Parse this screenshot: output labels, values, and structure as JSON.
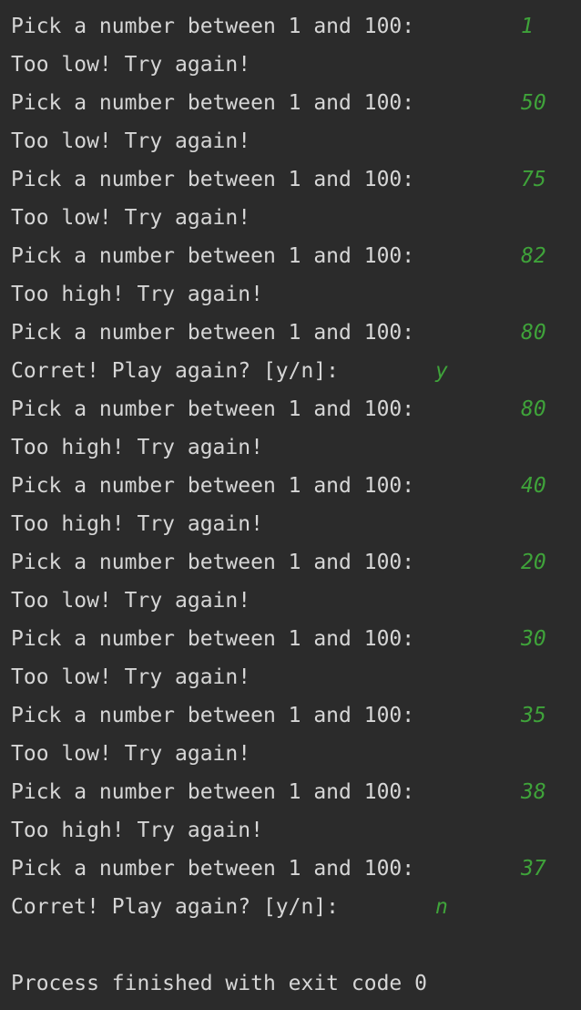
{
  "console": {
    "lines": [
      {
        "kind": "prompt",
        "text": "Pick a number between 1 and 100:",
        "input": "1"
      },
      {
        "kind": "output",
        "text": "Too low! Try again!"
      },
      {
        "kind": "prompt",
        "text": "Pick a number between 1 and 100:",
        "input": "50"
      },
      {
        "kind": "output",
        "text": "Too low! Try again!"
      },
      {
        "kind": "prompt",
        "text": "Pick a number between 1 and 100:",
        "input": "75"
      },
      {
        "kind": "output",
        "text": "Too low! Try again!"
      },
      {
        "kind": "prompt",
        "text": "Pick a number between 1 and 100:",
        "input": "82"
      },
      {
        "kind": "output",
        "text": "Too high! Try again!"
      },
      {
        "kind": "prompt",
        "text": "Pick a number between 1 and 100:",
        "input": "80"
      },
      {
        "kind": "answer",
        "text": "Corret! Play again? [y/n]:",
        "input": "y"
      },
      {
        "kind": "prompt",
        "text": "Pick a number between 1 and 100:",
        "input": "80"
      },
      {
        "kind": "output",
        "text": "Too high! Try again!"
      },
      {
        "kind": "prompt",
        "text": "Pick a number between 1 and 100:",
        "input": "40"
      },
      {
        "kind": "output",
        "text": "Too high! Try again!"
      },
      {
        "kind": "prompt",
        "text": "Pick a number between 1 and 100:",
        "input": "20"
      },
      {
        "kind": "output",
        "text": "Too low! Try again!"
      },
      {
        "kind": "prompt",
        "text": "Pick a number between 1 and 100:",
        "input": "30"
      },
      {
        "kind": "output",
        "text": "Too low! Try again!"
      },
      {
        "kind": "prompt",
        "text": "Pick a number between 1 and 100:",
        "input": "35"
      },
      {
        "kind": "output",
        "text": "Too low! Try again!"
      },
      {
        "kind": "prompt",
        "text": "Pick a number between 1 and 100:",
        "input": "38"
      },
      {
        "kind": "output",
        "text": "Too high! Try again!"
      },
      {
        "kind": "prompt",
        "text": "Pick a number between 1 and 100:",
        "input": "37"
      },
      {
        "kind": "answer",
        "text": "Corret! Play again? [y/n]:",
        "input": "n"
      },
      {
        "kind": "blank",
        "text": ""
      },
      {
        "kind": "output",
        "text": "Process finished with exit code 0"
      }
    ]
  },
  "colors": {
    "background": "#2b2b2b",
    "text": "#d6d6d6",
    "user_input": "#3fa33a"
  }
}
